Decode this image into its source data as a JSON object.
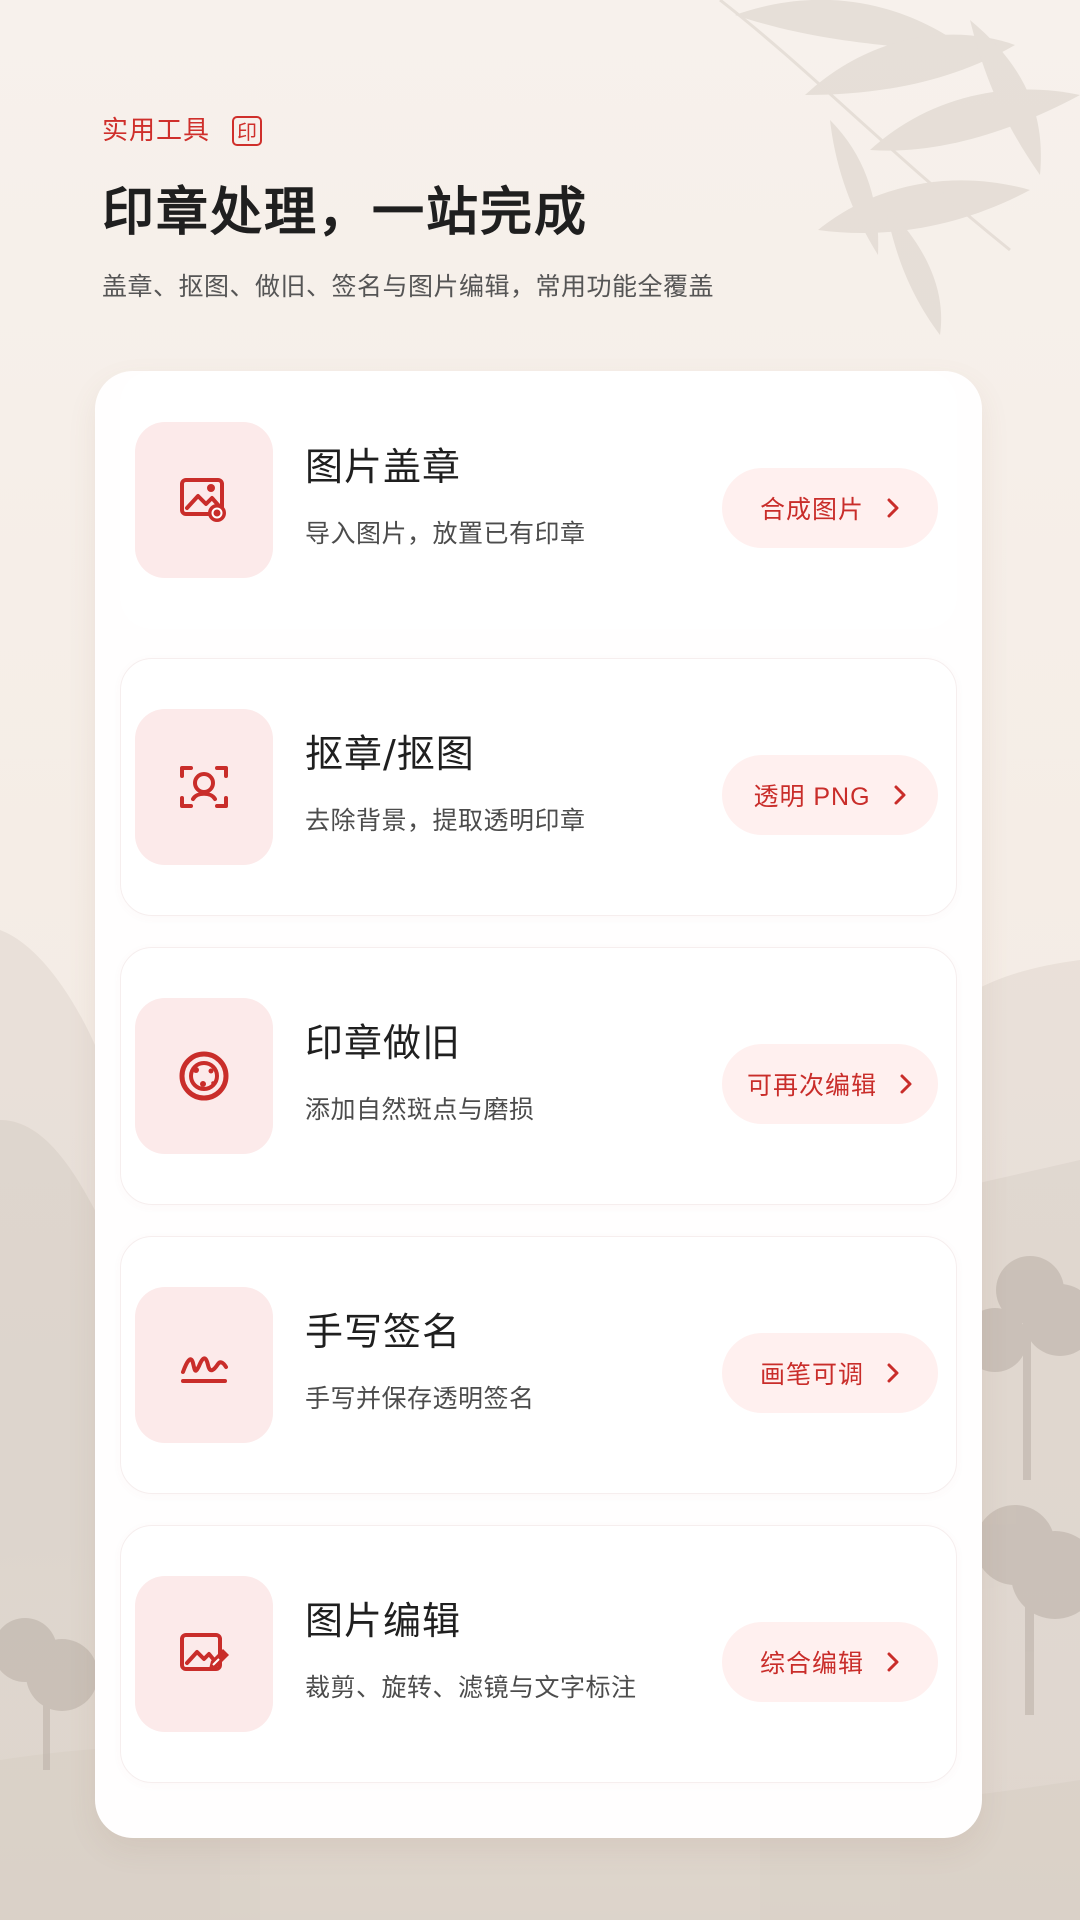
{
  "header": {
    "eyebrow": "实用工具",
    "badge": "印",
    "title": "印章处理，一站完成",
    "subtitle": "盖章、抠图、做旧、签名与图片编辑，常用功能全覆盖"
  },
  "tools": [
    {
      "icon": "image-stamp-icon",
      "title": "图片盖章",
      "description": "导入图片，放置已有印章",
      "action": "合成图片"
    },
    {
      "icon": "cutout-focus-icon",
      "title": "抠章/抠图",
      "description": "去除背景，提取透明印章",
      "action": "透明 PNG"
    },
    {
      "icon": "aged-seal-icon",
      "title": "印章做旧",
      "description": "添加自然斑点与磨损",
      "action": "可再次编辑"
    },
    {
      "icon": "signature-icon",
      "title": "手写签名",
      "description": "手写并保存透明签名",
      "action": "画笔可调"
    },
    {
      "icon": "image-edit-icon",
      "title": "图片编辑",
      "description": "裁剪、旋转、滤镜与文字标注",
      "action": "综合编辑"
    }
  ],
  "theme": {
    "accent": "#c92d2a",
    "tile_background": "#fceaea",
    "button_background": "#fff0ef"
  }
}
